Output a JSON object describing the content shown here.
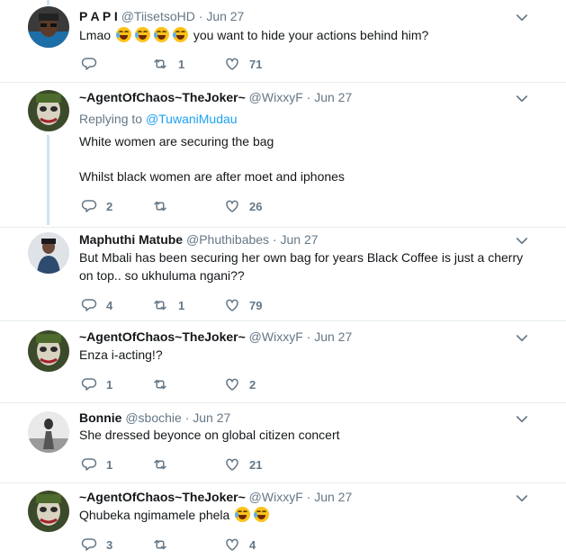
{
  "tweets": [
    {
      "name": "P A P I",
      "handle": "@TiisetsoHD",
      "separator": "·",
      "date": "Jun 27",
      "text_before_emoji": "Lmao",
      "text_after_emoji": "you want to hide your actions behind him?",
      "emoji_count": 4,
      "reply_count": "",
      "retweet_count": "1",
      "like_count": "71"
    },
    {
      "name": "~AgentOfChaos~TheJoker~",
      "handle": "@WixxyF",
      "separator": "·",
      "date": "Jun 27",
      "replying_label": "Replying to",
      "replying_handle": "@TuwaniMudau",
      "text_line1": "White women are securing the bag",
      "text_line2": "Whilst black women are after moet and iphones",
      "reply_count": "2",
      "retweet_count": "",
      "like_count": "26"
    },
    {
      "name": "Maphuthi Matube",
      "handle": "@Phuthibabes",
      "separator": "·",
      "date": "Jun 27",
      "text": "But Mbali has been securing her own bag for years Black Coffee is just a cherry on top.. so ukhuluma ngani??",
      "reply_count": "4",
      "retweet_count": "1",
      "like_count": "79"
    },
    {
      "name": "~AgentOfChaos~TheJoker~",
      "handle": "@WixxyF",
      "separator": "·",
      "date": "Jun 27",
      "text": "Enza i-acting!?",
      "reply_count": "1",
      "retweet_count": "",
      "like_count": "2"
    },
    {
      "name": "Bonnie",
      "handle": "@sbochie",
      "separator": "·",
      "date": "Jun 27",
      "text": "She dressed beyonce on global citizen concert",
      "reply_count": "1",
      "retweet_count": "",
      "like_count": "21"
    },
    {
      "name": "~AgentOfChaos~TheJoker~",
      "handle": "@WixxyF",
      "separator": "·",
      "date": "Jun 27",
      "text_before_emoji": "Qhubeka ngimamele phela",
      "emoji_count": 2,
      "reply_count": "3",
      "retweet_count": "",
      "like_count": "4"
    }
  ],
  "colors": {
    "link": "#1da1f2",
    "secondary_text": "#657786",
    "thread_line": "#cfe4f5",
    "divider": "#e6ecf0",
    "emoji": "#fcc21b"
  },
  "icons": [
    "caret-down-icon",
    "reply-icon",
    "retweet-icon",
    "heart-icon",
    "face-with-tears-of-joy-emoji"
  ]
}
